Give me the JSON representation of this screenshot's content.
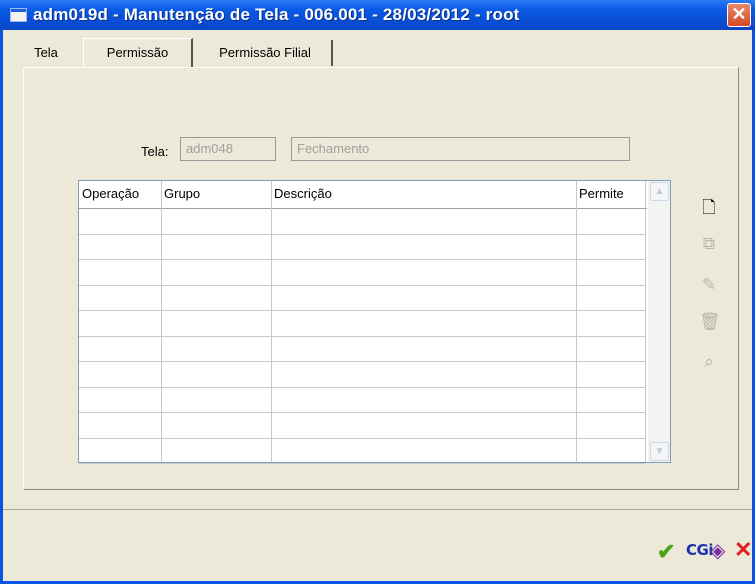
{
  "window": {
    "title": "adm019d - Manutenção de Tela - 006.001 - 28/03/2012 - root",
    "close_glyph": "✕"
  },
  "tabs": [
    {
      "label": "Tela",
      "active": false
    },
    {
      "label": "Permissão",
      "active": true
    },
    {
      "label": "Permissão Filial",
      "active": false
    }
  ],
  "form": {
    "tela_label": "Tela:",
    "tela_code": "adm048",
    "tela_desc": "Fechamento"
  },
  "grid": {
    "columns": [
      "Operação",
      "Grupo",
      "Descrição",
      "Permite"
    ],
    "rows": 10
  },
  "side_toolbar": {
    "icons": [
      "new-icon",
      "copy-icon",
      "edit-icon",
      "delete-icon",
      "search-icon"
    ],
    "enabled": [
      true,
      false,
      false,
      false,
      false
    ]
  },
  "bottom_toolbar": {
    "ok_glyph": "✔",
    "cgi_label": "CGi",
    "cancel_glyph": "✕"
  },
  "colors": {
    "titlebar": "#0a5be6",
    "background": "#ece9d8",
    "ok": "#4aa417",
    "cgi": "#1d2fb0",
    "cancel": "#e02020"
  }
}
